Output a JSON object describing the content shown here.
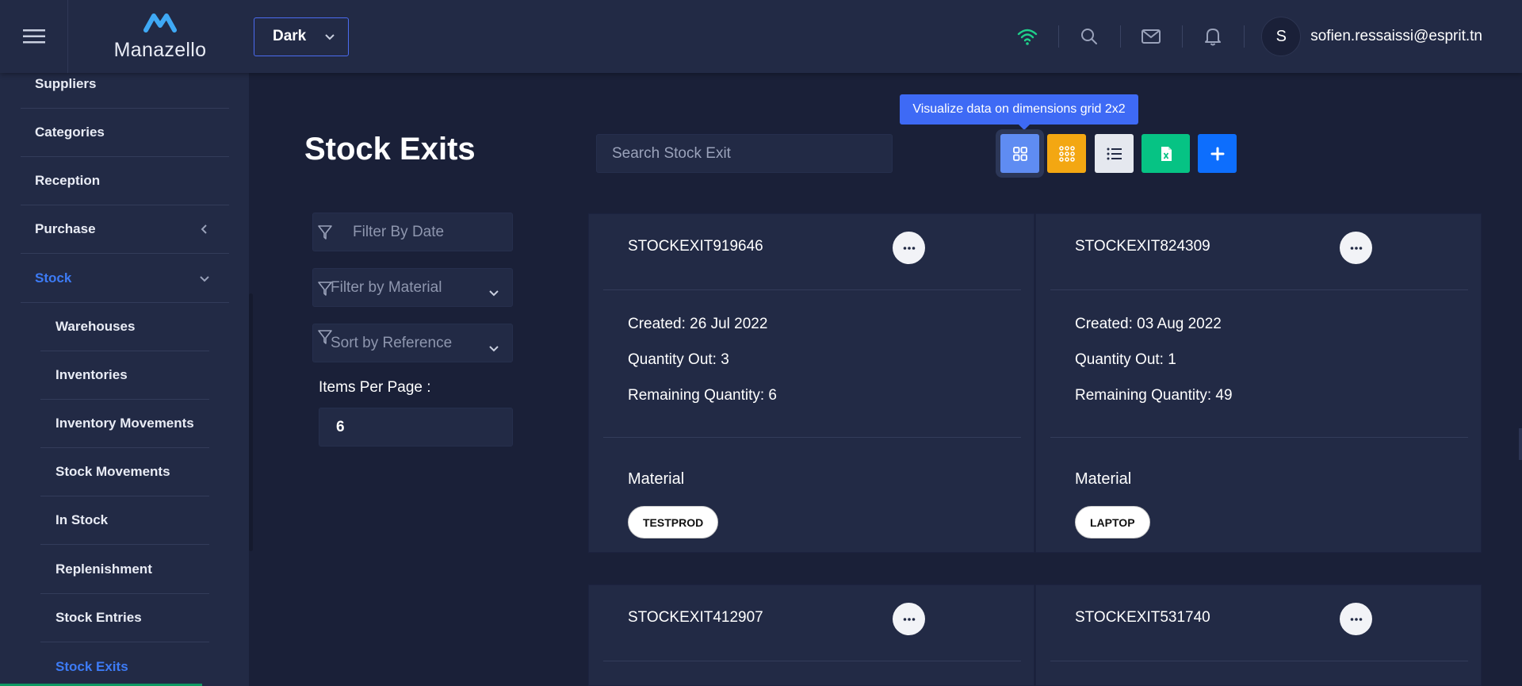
{
  "header": {
    "brand": "Manazello",
    "theme": "Dark",
    "user_initial": "S",
    "user_email": "sofien.ressaissi@esprit.tn"
  },
  "sidebar": {
    "items": [
      {
        "label": "Suppliers"
      },
      {
        "label": "Categories"
      },
      {
        "label": "Reception"
      },
      {
        "label": "Purchase"
      },
      {
        "label": "Stock"
      }
    ],
    "sub_items": [
      {
        "label": "Warehouses"
      },
      {
        "label": "Inventories"
      },
      {
        "label": "Inventory Movements"
      },
      {
        "label": "Stock Movements"
      },
      {
        "label": "In Stock"
      },
      {
        "label": "Replenishment"
      },
      {
        "label": "Stock Entries"
      },
      {
        "label": "Stock Exits"
      }
    ]
  },
  "main": {
    "title": "Stock Exits",
    "search_placeholder": "Search Stock Exit",
    "tooltip": "Visualize data on dimensions grid 2x2",
    "filters": {
      "date": "Filter By Date",
      "material": "Filter by Material",
      "sort": "Sort by Reference"
    },
    "items_per_page_label": "Items Per Page :",
    "items_per_page": "6"
  },
  "cards": [
    {
      "ref": "STOCKEXIT919646",
      "created": "Created: 26 Jul 2022",
      "qty_out": "Quantity Out: 3",
      "remaining": "Remaining Quantity: 6",
      "material_label": "Material",
      "material": "TESTPROD"
    },
    {
      "ref": "STOCKEXIT824309",
      "created": "Created: 03 Aug 2022",
      "qty_out": "Quantity Out: 1",
      "remaining": "Remaining Quantity: 49",
      "material_label": "Material",
      "material": "LAPTOP"
    },
    {
      "ref": "STOCKEXIT412907"
    },
    {
      "ref": "STOCKEXIT531740"
    }
  ],
  "colors": {
    "background": "#1a2038",
    "panel": "#222a45",
    "accent": "#3e6af5",
    "active_link": "#3d7bf5"
  }
}
